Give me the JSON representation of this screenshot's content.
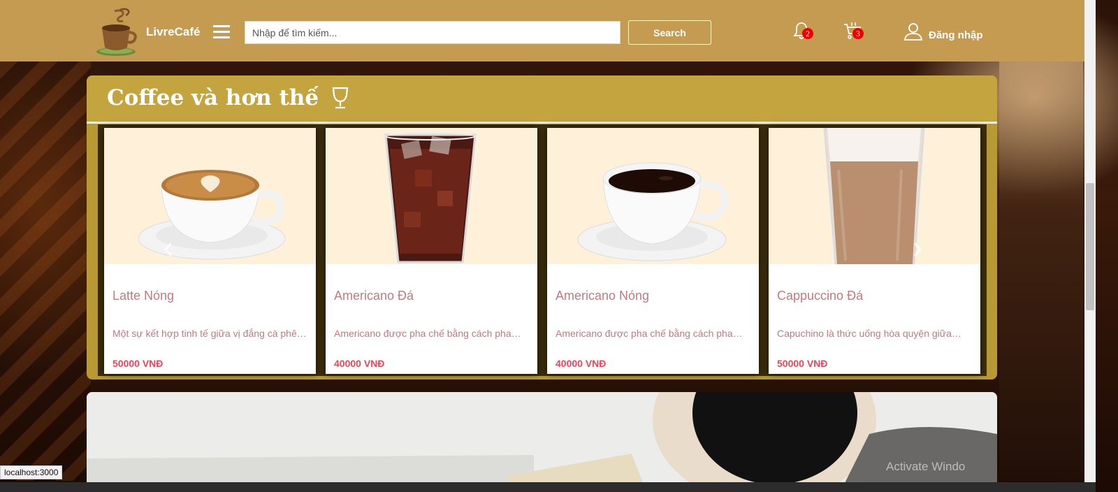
{
  "header": {
    "brand": "LivreCafé",
    "search_placeholder": "Nhập để tìm kiếm...",
    "search_button": "Search",
    "notification_count": "2",
    "cart_count": "3",
    "login_label": "Đăng nhập"
  },
  "section": {
    "title": "Coffee và hơn thế"
  },
  "products": [
    {
      "name": "Latte Nóng",
      "description": "Một sự kết hợp tinh tế giữa vị đắng cà phê…",
      "price": "50000 VNĐ",
      "image": "latte-cup"
    },
    {
      "name": "Americano Đá",
      "description": "Americano được pha chế bằng cách pha…",
      "price": "40000 VNĐ",
      "image": "iced-americano-glass"
    },
    {
      "name": "Americano Nóng",
      "description": "Americano được pha chế bằng cách pha…",
      "price": "40000 VNĐ",
      "image": "black-coffee-cup"
    },
    {
      "name": "Cappuccino Đá",
      "description": "Capuchino là thức uống hòa quyện giữa…",
      "price": "50000 VNĐ",
      "image": "iced-cappuccino-glass"
    }
  ],
  "status_bar": {
    "url": "localhost:3000"
  },
  "overlay": {
    "watermark": "Activate Windo"
  },
  "colors": {
    "header_bg": "#c49b50",
    "panel_bg": "#c4a43f",
    "product_name": "#c07a80",
    "price": "#f0435a",
    "badge": "#e00000"
  }
}
